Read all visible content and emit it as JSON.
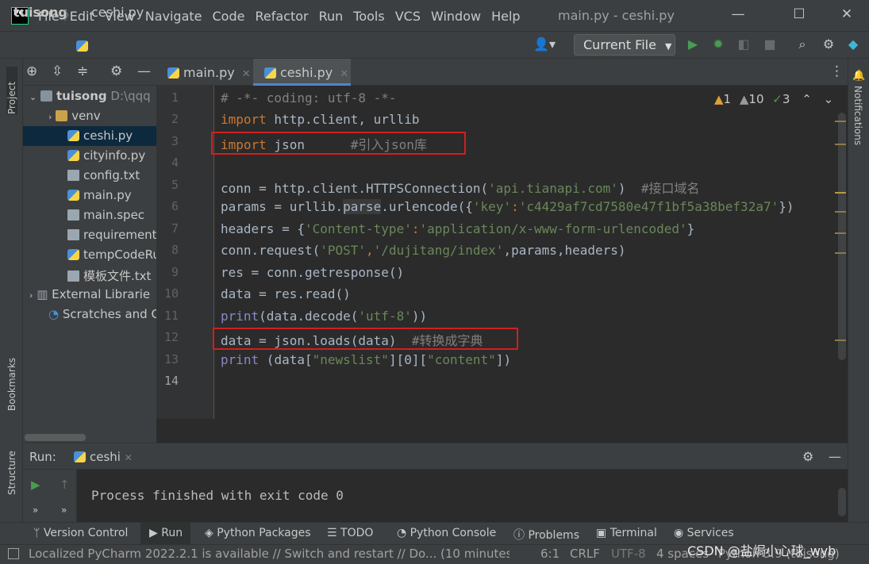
{
  "menu": [
    "File",
    "Edit",
    "View",
    "Navigate",
    "Code",
    "Refactor",
    "Run",
    "Tools",
    "VCS",
    "Window",
    "Help"
  ],
  "window_title": "main.py - ceshi.py",
  "logo_text": "PC",
  "breadcrumb": {
    "project": "tuisong",
    "file": "ceshi.py"
  },
  "run_config": "Current File",
  "left_stripe": {
    "project": "Project",
    "bookmarks": "Bookmarks",
    "structure": "Structure"
  },
  "right_stripe": {
    "notifications": "Notifications"
  },
  "project_tree": [
    {
      "label": "tuisong",
      "extra": "D:\\qqq",
      "type": "root"
    },
    {
      "label": "venv",
      "type": "folder"
    },
    {
      "label": "ceshi.py",
      "type": "py",
      "selected": true
    },
    {
      "label": "cityinfo.py",
      "type": "py"
    },
    {
      "label": "config.txt",
      "type": "txt"
    },
    {
      "label": "main.py",
      "type": "py"
    },
    {
      "label": "main.spec",
      "type": "txt"
    },
    {
      "label": "requirement",
      "type": "txt"
    },
    {
      "label": "tempCodeRu",
      "type": "py"
    },
    {
      "label": "模板文件.txt",
      "type": "txt"
    },
    {
      "label": "External Librarie",
      "type": "lib"
    },
    {
      "label": "Scratches and C",
      "type": "scratch"
    }
  ],
  "tabs": [
    {
      "label": "main.py",
      "active": false
    },
    {
      "label": "ceshi.py",
      "active": true
    }
  ],
  "inspections": {
    "warnings_a": "1",
    "warnings_b": "10",
    "ok": "3"
  },
  "line_numbers": [
    "1",
    "2",
    "3",
    "4",
    "5",
    "6",
    "7",
    "8",
    "9",
    "10",
    "11",
    "12",
    "13",
    "14"
  ],
  "code": {
    "l1": "# -*- coding: utf-8 -*-",
    "l2_kw": "import",
    "l2_rest": " http.client, urllib",
    "l3_kw": "import",
    "l3_rest": " json",
    "l3_cm": "#引入json库",
    "l5_a": "conn = http.client.HTTPSConnection(",
    "l5_s": "'api.tianapi.com'",
    "l5_b": ")  ",
    "l5_cm": "#接口域名",
    "l6_a": "params = urllib.",
    "l6_hl": "parse",
    "l6_b": ".urlencode({",
    "l6_s1": "'key'",
    "l6_c": ":",
    "l6_s2": "'c4429af7cd7580e47f1bf5a38bef32a7'",
    "l6_d": "})",
    "l7_a": "headers = {",
    "l7_s1": "'Content-type'",
    "l7_c": ":",
    "l7_s2": "'application/x-www-form-urlencoded'",
    "l7_d": "}",
    "l8_a": "conn.request(",
    "l8_s1": "'POST'",
    "l8_c": ",",
    "l8_s2": "'/dujitang/index'",
    "l8_d": ",params,headers)",
    "l9": "res = conn.getresponse()",
    "l10": "data = res.read()",
    "l11_bi": "print",
    "l11_a": "(data.decode(",
    "l11_s": "'utf-8'",
    "l11_b": "))",
    "l12_a": "data = json.loads(data)  ",
    "l12_cm": "#转换成字典",
    "l13_bi": "print",
    "l13_a": " (data[",
    "l13_s1": "\"newslist\"",
    "l13_b": "][0][",
    "l13_s2": "\"content\"",
    "l13_c": "])"
  },
  "run_panel": {
    "label": "Run:",
    "config": "ceshi",
    "output": "Process finished with exit code 0"
  },
  "bottom_tools": [
    "Version Control",
    "Run",
    "Python Packages",
    "TODO",
    "Python Console",
    "Problems",
    "Terminal",
    "Services"
  ],
  "status": {
    "message": "Localized PyCharm 2022.2.1 is available // Switch and restart // Do... (10 minutes agc",
    "position": "6:1",
    "line_sep": "CRLF",
    "encoding": "UTF-8",
    "indent": "4 spaces",
    "interpreter": "Python 3.9 (tuisong)",
    "watermark": "CSDN @盐焗小心球_wyb"
  }
}
